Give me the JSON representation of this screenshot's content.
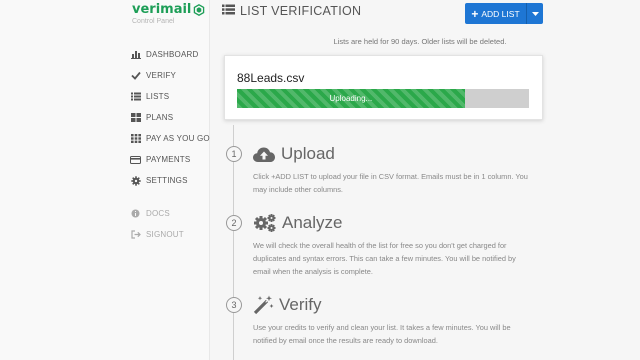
{
  "brand": {
    "name": "verimail",
    "subtitle": "Control Panel",
    "color": "#1d9e57"
  },
  "sidebar": {
    "items": [
      {
        "label": "DASHBOARD",
        "icon": "bar-chart-icon"
      },
      {
        "label": "VERIFY",
        "icon": "check-icon"
      },
      {
        "label": "LISTS",
        "icon": "list-icon"
      },
      {
        "label": "PLANS",
        "icon": "grid-large-icon"
      },
      {
        "label": "PAY AS YOU GO",
        "icon": "grid-small-icon"
      },
      {
        "label": "PAYMENTS",
        "icon": "credit-card-icon"
      },
      {
        "label": "SETTINGS",
        "icon": "gear-icon"
      }
    ],
    "secondary": [
      {
        "label": "DOCS",
        "icon": "info-icon"
      },
      {
        "label": "SIGNOUT",
        "icon": "sign-out-icon"
      }
    ]
  },
  "header": {
    "title": "LIST VERIFICATION",
    "add_button_label": "ADD LIST",
    "accent": "#1e76d4"
  },
  "notice": "Lists are held for 90 days. Older lists will be deleted.",
  "upload": {
    "file_name": "88Leads.csv",
    "status": "Uploading...",
    "progress": 0.78,
    "progress_color": "#2ba84a"
  },
  "steps": [
    {
      "number": "1",
      "title": "Upload",
      "icon": "cloud-upload-icon",
      "description": "Click +ADD LIST to upload your file in CSV format. Emails must be in 1 column. You may include other columns."
    },
    {
      "number": "2",
      "title": "Analyze",
      "icon": "gears-icon",
      "description": "We will check the overall health of the list for free so you don't get charged for duplicates and syntax errors. This can take a few minutes. You will be notified by email when the analysis is complete."
    },
    {
      "number": "3",
      "title": "Verify",
      "icon": "magic-wand-icon",
      "description": "Use your credits to verify and clean your list. It takes a few minutes. You will be notified by email once the results are ready to download."
    }
  ]
}
